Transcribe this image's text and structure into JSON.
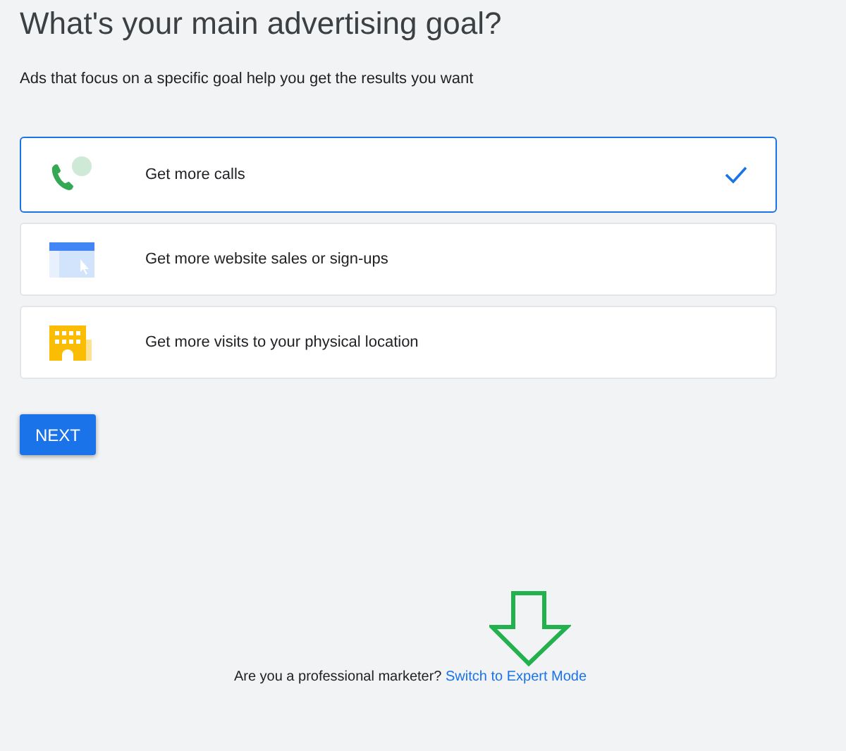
{
  "heading": "What's your main advertising goal?",
  "subtitle": "Ads that focus on a specific goal help you get the results you want",
  "goals": [
    {
      "kind": "calls",
      "label": "Get more calls",
      "selected": true
    },
    {
      "kind": "website",
      "label": "Get more website sales or sign-ups",
      "selected": false
    },
    {
      "kind": "visits",
      "label": "Get more visits to your physical location",
      "selected": false
    }
  ],
  "next_button": "NEXT",
  "footer": {
    "question": "Are you a professional marketer?",
    "link": "Switch to Expert Mode"
  }
}
